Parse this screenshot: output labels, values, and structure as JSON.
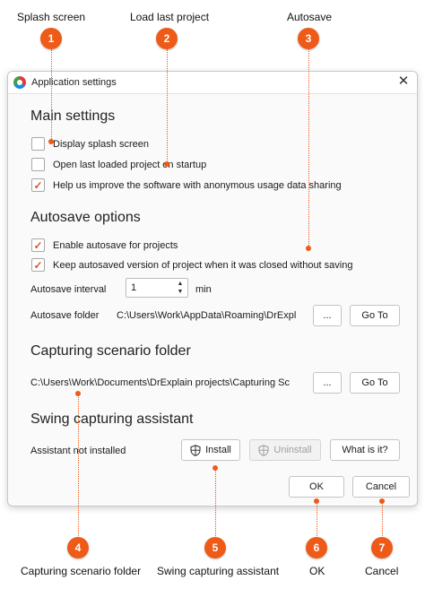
{
  "callouts": [
    {
      "number": "1",
      "label": "Splash screen"
    },
    {
      "number": "2",
      "label": "Load last project"
    },
    {
      "number": "3",
      "label": "Autosave"
    },
    {
      "number": "4",
      "label": "Capturing scenario folder"
    },
    {
      "number": "5",
      "label": "Swing capturing assistant"
    },
    {
      "number": "6",
      "label": "OK"
    },
    {
      "number": "7",
      "label": "Cancel"
    }
  ],
  "window": {
    "title": "Application settings",
    "close_glyph": "✕",
    "icon": "app-logo-icon"
  },
  "main_settings": {
    "title": "Main settings",
    "display_splash": {
      "label": "Display splash screen",
      "checked": false
    },
    "open_last_project": {
      "label": "Open last loaded project on startup",
      "checked": false
    },
    "usage_sharing": {
      "label": "Help us improve the software with anonymous usage data sharing",
      "checked": true
    }
  },
  "autosave": {
    "title": "Autosave options",
    "enable": {
      "label": "Enable autosave for projects",
      "checked": true
    },
    "keep_version": {
      "label": "Keep autosaved version of project when it was closed without saving",
      "checked": true
    },
    "interval_label": "Autosave interval",
    "interval_value": "1",
    "interval_unit": "min",
    "folder_label": "Autosave folder",
    "folder_path": "C:\\Users\\Work\\AppData\\Roaming\\DrExpl",
    "browse_label": "...",
    "goto_label": "Go To"
  },
  "capturing_folder": {
    "title": "Capturing scenario folder",
    "path": "C:\\Users\\Work\\Documents\\DrExplain projects\\Capturing Sc",
    "browse_label": "...",
    "goto_label": "Go To"
  },
  "swing": {
    "title": "Swing capturing assistant",
    "status": "Assistant not installed",
    "install_label": "Install",
    "uninstall_label": "Uninstall",
    "what_label": "What is it?",
    "icon": "shield-icon"
  },
  "footer": {
    "ok_label": "OK",
    "cancel_label": "Cancel"
  },
  "check_glyph": "✓",
  "spin_up": "▲",
  "spin_down": "▼",
  "colors": {
    "accent": "#ee5a17",
    "check": "#d9532a"
  }
}
